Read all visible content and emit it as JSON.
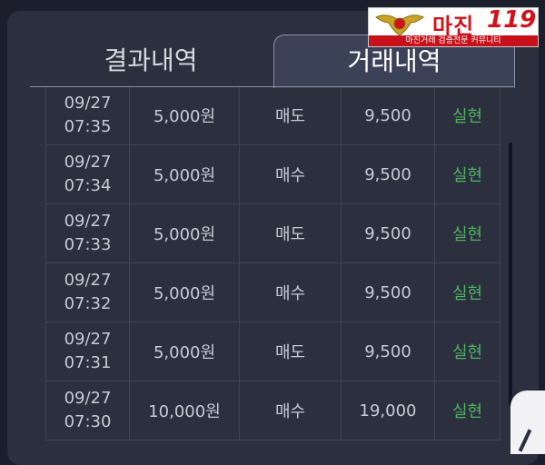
{
  "tabs": {
    "result_history": "결과내역",
    "trade_history": "거래내역"
  },
  "trades": [
    {
      "date": "09/27",
      "time": "07:35",
      "amount": "5,000원",
      "type": "매도",
      "price": "9,500",
      "status": "실현"
    },
    {
      "date": "09/27",
      "time": "07:34",
      "amount": "5,000원",
      "type": "매수",
      "price": "9,500",
      "status": "실현"
    },
    {
      "date": "09/27",
      "time": "07:33",
      "amount": "5,000원",
      "type": "매도",
      "price": "9,500",
      "status": "실현"
    },
    {
      "date": "09/27",
      "time": "07:32",
      "amount": "5,000원",
      "type": "매수",
      "price": "9,500",
      "status": "실현"
    },
    {
      "date": "09/27",
      "time": "07:31",
      "amount": "5,000원",
      "type": "매도",
      "price": "9,500",
      "status": "실현"
    },
    {
      "date": "09/27",
      "time": "07:30",
      "amount": "10,000원",
      "type": "매수",
      "price": "19,000",
      "status": "실현"
    }
  ],
  "watermark": {
    "brand": "마진",
    "number": "119",
    "tagline": "마진거래 검증전문 커뮤니티"
  },
  "colors": {
    "background": "#1c1f2b",
    "panel": "#2b2f3e",
    "active_tab": "#3b4157",
    "status_green": "#4fb35f",
    "watermark_red": "#d0121b"
  }
}
